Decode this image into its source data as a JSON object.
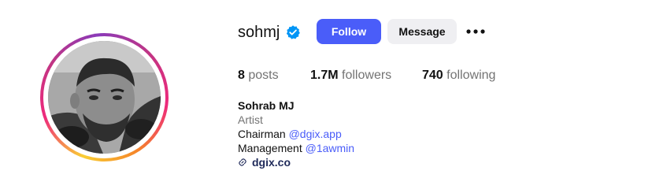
{
  "profile": {
    "username": "sohmj",
    "verified_icon": "verified-badge-icon",
    "buttons": {
      "follow_label": "Follow",
      "message_label": "Message",
      "more_icon": "more-options-icon"
    },
    "stats": {
      "posts_count": "8",
      "posts_label": "posts",
      "followers_count": "1.7M",
      "followers_label": "followers",
      "following_count": "740",
      "following_label": "following"
    },
    "bio": {
      "full_name": "Sohrab MJ",
      "category": "Artist",
      "chairman_text": "Chairman",
      "chairman_mention": "@dgix.app",
      "management_text": "Management",
      "management_mention": "@1awmin",
      "website": "dgix.co",
      "website_icon": "link-icon"
    }
  },
  "colors": {
    "accent": "#4a5df9",
    "follow_button_bg": "#4a5df9",
    "message_button_bg": "#efeff2",
    "verified_badge": "#0095f6",
    "muted_text": "#737373"
  }
}
